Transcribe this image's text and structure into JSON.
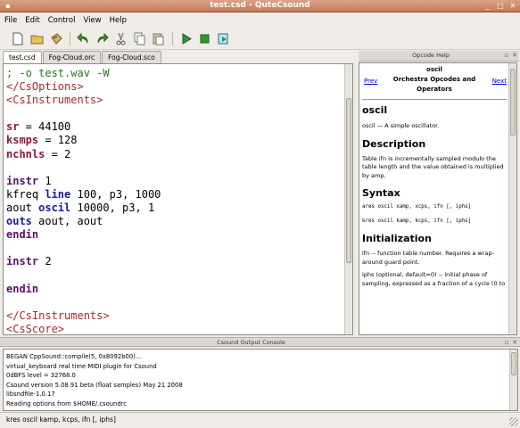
{
  "window": {
    "title": "test.csd - QuteCsound"
  },
  "menubar": {
    "items": [
      "File",
      "Edit",
      "Control",
      "View",
      "Help"
    ]
  },
  "toolbar": {
    "icons": [
      "new-file-icon",
      "open-folder-icon",
      "save-icon",
      "undo-icon",
      "redo-icon",
      "cut-icon",
      "copy-icon",
      "paste-icon",
      "run-icon",
      "stop-icon",
      "render-icon"
    ]
  },
  "tabs": [
    "test.csd",
    "Fog-Cloud.orc",
    "Fog-Cloud.sco"
  ],
  "editor": {
    "lines": [
      [
        {
          "t": "; -o test.wav -W",
          "c": "#217a21"
        }
      ],
      [
        {
          "t": "</CsOptions>",
          "c": "#a52a2a"
        }
      ],
      [
        {
          "t": "<CsInstruments>",
          "c": "#a52a2a"
        }
      ],
      [],
      [
        {
          "t": "sr",
          "c": "#8b1a3f",
          "b": true
        },
        {
          "t": " = 44100",
          "c": "#000000"
        }
      ],
      [
        {
          "t": "ksmps",
          "c": "#8b1a3f",
          "b": true
        },
        {
          "t": " = 128",
          "c": "#000000"
        }
      ],
      [
        {
          "t": "nchnls",
          "c": "#8b1a3f",
          "b": true
        },
        {
          "t": " = 2",
          "c": "#000000"
        }
      ],
      [],
      [
        {
          "t": "instr",
          "c": "#5b0f6e",
          "b": true
        },
        {
          "t": " 1",
          "c": "#000000"
        }
      ],
      [
        {
          "t": "kfreq ",
          "c": "#000000"
        },
        {
          "t": "line",
          "c": "#1a1a9e",
          "b": true
        },
        {
          "t": " 100, p3, 1000",
          "c": "#000000"
        }
      ],
      [
        {
          "t": "aout ",
          "c": "#000000"
        },
        {
          "t": "oscil",
          "c": "#1a1a9e",
          "b": true
        },
        {
          "t": " 10000, p3, 1",
          "c": "#000000"
        }
      ],
      [
        {
          "t": "outs",
          "c": "#1a1a9e",
          "b": true
        },
        {
          "t": " aout, aout",
          "c": "#000000"
        }
      ],
      [
        {
          "t": "endin",
          "c": "#5b0f6e",
          "b": true
        }
      ],
      [],
      [
        {
          "t": "instr",
          "c": "#5b0f6e",
          "b": true
        },
        {
          "t": " 2",
          "c": "#000000"
        }
      ],
      [],
      [
        {
          "t": "endin",
          "c": "#5b0f6e",
          "b": true
        }
      ],
      [],
      [
        {
          "t": "</CsInstruments>",
          "c": "#a52a2a"
        }
      ],
      [
        {
          "t": "<CsScore>",
          "c": "#a52a2a"
        }
      ]
    ]
  },
  "help": {
    "header": "Opcode Help",
    "prev": "Prev",
    "next": "Next",
    "opcode": "oscil",
    "category": "Orchestra Opcodes and Operators",
    "heading": "oscil",
    "summary": "oscil — A simple oscillator.",
    "description_title": "Description",
    "description": "Table ifn is incrementally sampled modulo the table length and the value obtained is multiplied by amp.",
    "syntax_title": "Syntax",
    "syntax1": "ares oscil xamp, xcps, ifn [, iphs]",
    "syntax2": "kres oscil kamp, kcps, ifn [, iphs]",
    "init_title": "Initialization",
    "init1": "ifn -- function table number. Requires a wrap-around guard point.",
    "init2": "iphs (optional, default=0) -- initial phase of sampling, expressed as a fraction of a cycle (0 to"
  },
  "console": {
    "header": "Csound Output Console",
    "lines": [
      "BEGAN CppSound::compile(5, 0x8092b00)...",
      "virtual_keyboard real time MIDI plugin for Csound",
      "0dBFS level = 32768.0",
      "Csound version 5.08.91 beta (float samples) May 21 2008",
      "libsndfile-1.0.17",
      "Reading options from $HOME/.csoundrc"
    ]
  },
  "statusbar": {
    "text": "kres  oscil  kamp, kcps, ifn [, iphs]"
  }
}
